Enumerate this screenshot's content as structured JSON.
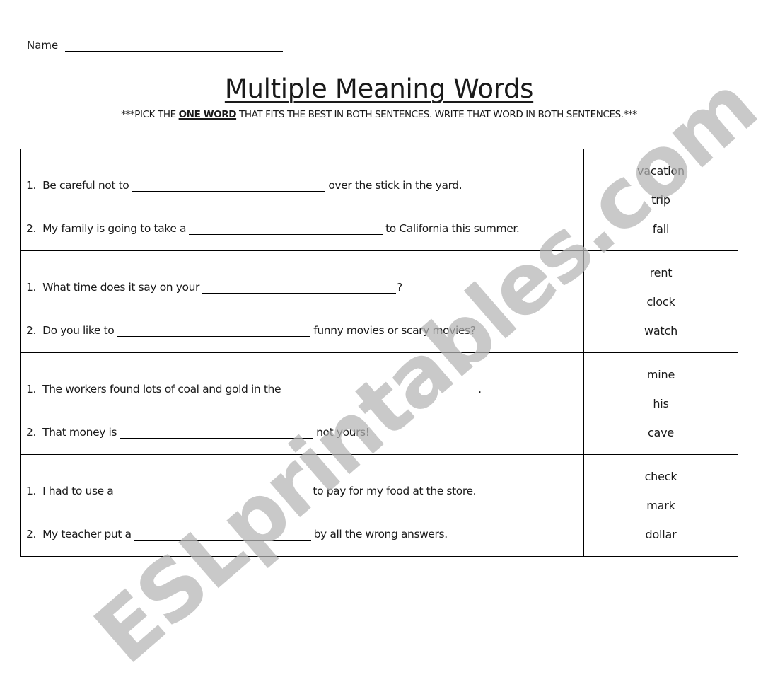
{
  "header": {
    "name_label": "Name"
  },
  "title": "Multiple Meaning Words",
  "instructions": {
    "prefix": "***PICK THE ",
    "emphasis": "ONE WORD",
    "suffix": " THAT FITS THE BEST IN BOTH SENTENCES.  WRITE THAT WORD IN BOTH SENTENCES.***"
  },
  "rows": [
    {
      "sentence1": {
        "number": "1.",
        "before": "Be careful not to",
        "after": "over the stick in the yard."
      },
      "sentence2": {
        "number": "2.",
        "before": "My family is going to take a",
        "after": "to California this summer."
      },
      "choices": [
        "vacation",
        "trip",
        "fall"
      ]
    },
    {
      "sentence1": {
        "number": "1.",
        "before": "What time does it say on your",
        "after": "?"
      },
      "sentence2": {
        "number": "2.",
        "before": " Do you like to",
        "after": "funny movies or scary movies?"
      },
      "choices": [
        "rent",
        "clock",
        "watch"
      ]
    },
    {
      "sentence1": {
        "number": "1.",
        "before": "The workers found lots of coal and gold in the",
        "after": "."
      },
      "sentence2": {
        "number": "2.",
        "before": "That money is",
        "after": "not yours!"
      },
      "choices": [
        "mine",
        "his",
        "cave"
      ]
    },
    {
      "sentence1": {
        "number": "1.",
        "before": "I had to use a",
        "after": "to pay for my food at the store."
      },
      "sentence2": {
        "number": "2.",
        "before": "My teacher put a",
        "after": "by all the wrong answers."
      },
      "choices": [
        "check",
        "mark",
        "dollar"
      ]
    }
  ],
  "watermark": "ESLprintables.com"
}
